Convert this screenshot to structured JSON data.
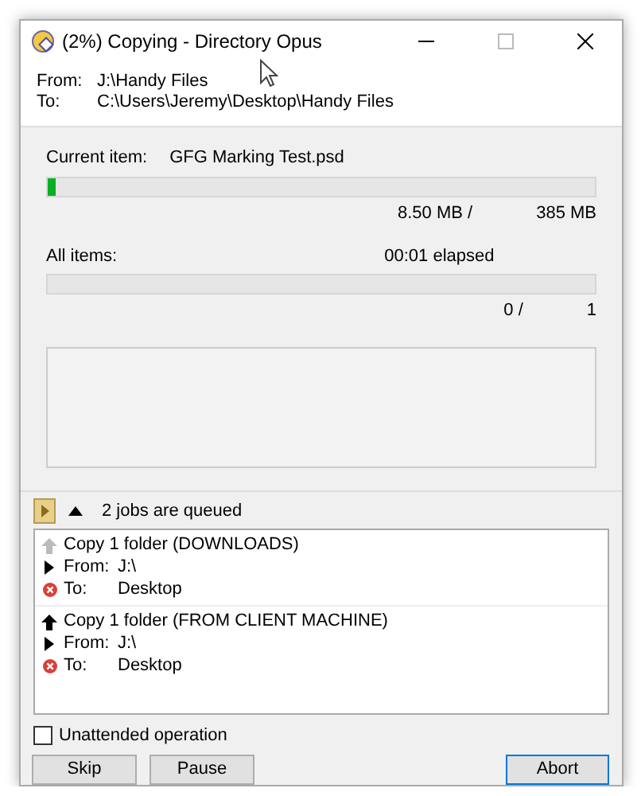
{
  "window": {
    "title": "(2%) Copying - Directory Opus"
  },
  "header": {
    "from_label": "From:",
    "from": "J:\\Handy Files",
    "to_label": "To:",
    "to": "C:\\Users\\Jeremy\\Desktop\\Handy Files"
  },
  "current_item": {
    "label": "Current item:",
    "name": "GFG Marking Test.psd",
    "level": 0.015,
    "done": "8.50 MB /",
    "total": "385 MB"
  },
  "all_items": {
    "label": "All items:",
    "elapsed": "00:01 elapsed",
    "level": 0,
    "done": "0 /",
    "total": "1"
  },
  "queue": {
    "summary": "2 jobs are queued",
    "expanded": true,
    "jobs": [
      {
        "title": "Copy 1 folder (DOWNLOADS)",
        "can_move_up": false,
        "from_label": "From:",
        "from": "J:\\",
        "to_label": "To:",
        "to": "Desktop"
      },
      {
        "title": "Copy 1 folder (FROM CLIENT MACHINE)",
        "can_move_up": true,
        "from_label": "From:",
        "from": "J:\\",
        "to_label": "To:",
        "to": "Desktop"
      }
    ]
  },
  "unattended": {
    "label": "Unattended operation",
    "checked": false
  },
  "buttons": [
    {
      "label": "Skip",
      "default": false
    },
    {
      "label": "Pause",
      "default": false
    },
    {
      "label": "Abort",
      "default": true
    }
  ]
}
